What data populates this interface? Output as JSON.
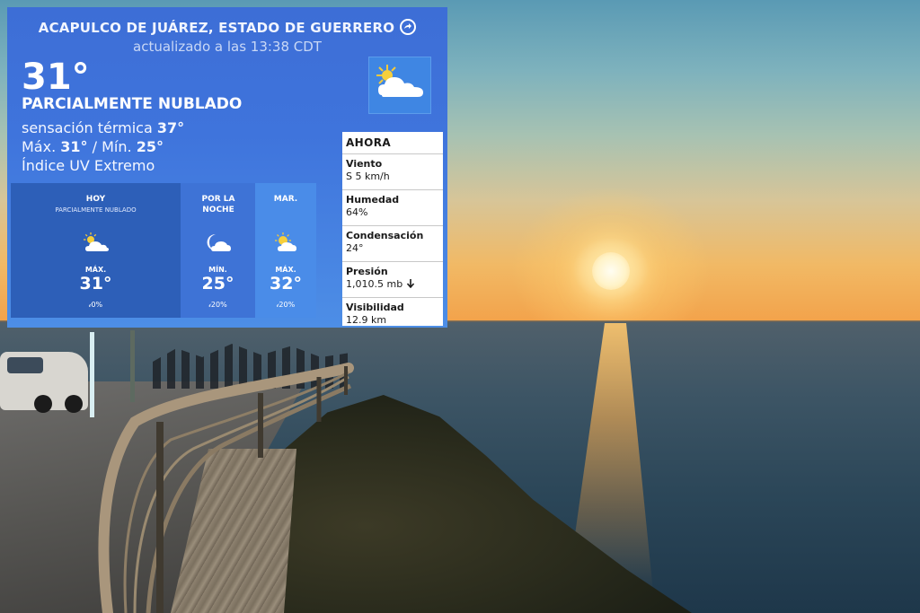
{
  "colors": {
    "widget_blue": "#3f74dc",
    "today_column": "#2d5fb8",
    "night_column": "#3e73d6",
    "tuesday_column": "#4a8ce8",
    "panel_white": "#ffffff"
  },
  "widget": {
    "location": "ACAPULCO DE JUÁREZ, ESTADO DE GUERRERO",
    "location_icon": "arrow-circle-icon",
    "updated": "actualizado a las 13:38 CDT",
    "temperature": "31°",
    "condition": "PARCIALMENTE NUBLADO",
    "condition_icon": "partly-cloudy-icon",
    "feels_like_label": "sensación térmica",
    "feels_like_value": "37°",
    "max_label": "Máx.",
    "max_value": "31°",
    "separator": "/",
    "min_label": "Mín.",
    "min_value": "25°",
    "uv": "Índice UV Extremo"
  },
  "forecast": [
    {
      "title": "HOY",
      "subtitle": "PARCIALMENTE NUBLADO",
      "icon": "partly-cloudy-icon",
      "label": "MÁX.",
      "temp": "31°",
      "rain": "0%"
    },
    {
      "title": "POR LA NOCHE",
      "subtitle": "",
      "icon": "cloudy-night-icon",
      "label": "MÍN.",
      "temp": "25°",
      "rain": "20%"
    },
    {
      "title": "MAR.",
      "subtitle": "",
      "icon": "partly-cloudy-icon",
      "label": "MÁX.",
      "temp": "32°",
      "rain": "20%"
    }
  ],
  "ahora": {
    "title": "AHORA",
    "rows": [
      {
        "label": "Viento",
        "value": "S 5 km/h"
      },
      {
        "label": "Humedad",
        "value": "64%"
      },
      {
        "label": "Condensación",
        "value": "24°"
      },
      {
        "label": "Presión",
        "value": "1,010.5 mb",
        "trend_icon": "arrow-down-icon"
      },
      {
        "label": "Visibilidad",
        "value": "12.9 km"
      }
    ]
  }
}
